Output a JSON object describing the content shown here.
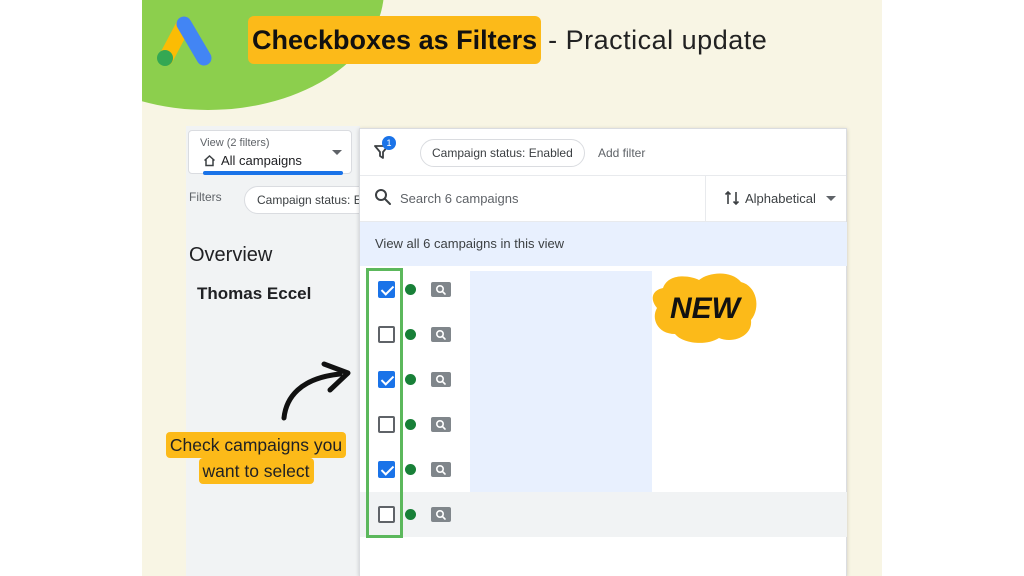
{
  "headline": {
    "highlighted": "Checkboxes as Filters",
    "rest": "- Practical update"
  },
  "colors": {
    "accent_yellow": "#fcba19",
    "corner_green": "#8ccf4d",
    "checkbox_blue": "#1a73e8",
    "status_green": "#188038",
    "highlight_border": "#5cb85c"
  },
  "left_panel": {
    "view_selector": {
      "small_label": "View (2 filters)",
      "value": "All campaigns"
    },
    "filters_label": "Filters",
    "filter_chip": "Campaign status: E",
    "overview_title": "Overview",
    "account_name": "Thomas Eccel"
  },
  "filter_panel": {
    "filter_count_badge": "1",
    "status_chip": "Campaign status: Enabled",
    "add_filter_label": "Add filter",
    "search": {
      "placeholder": "Search 6 campaigns",
      "value": ""
    },
    "sort_label": "Alphabetical",
    "view_all_label": "View all 6 campaigns in this view",
    "campaigns": [
      {
        "checked": true
      },
      {
        "checked": false
      },
      {
        "checked": true
      },
      {
        "checked": false
      },
      {
        "checked": true
      },
      {
        "checked": false
      }
    ]
  },
  "new_badge": "NEW",
  "callout": {
    "line1": "Check campaigns you",
    "line2": "want to select"
  },
  "icons": [
    "google-ads-logo-icon",
    "home-icon",
    "filter-icon",
    "search-icon",
    "sort-arrows-icon",
    "search-campaign-icon",
    "curved-arrow-icon"
  ]
}
